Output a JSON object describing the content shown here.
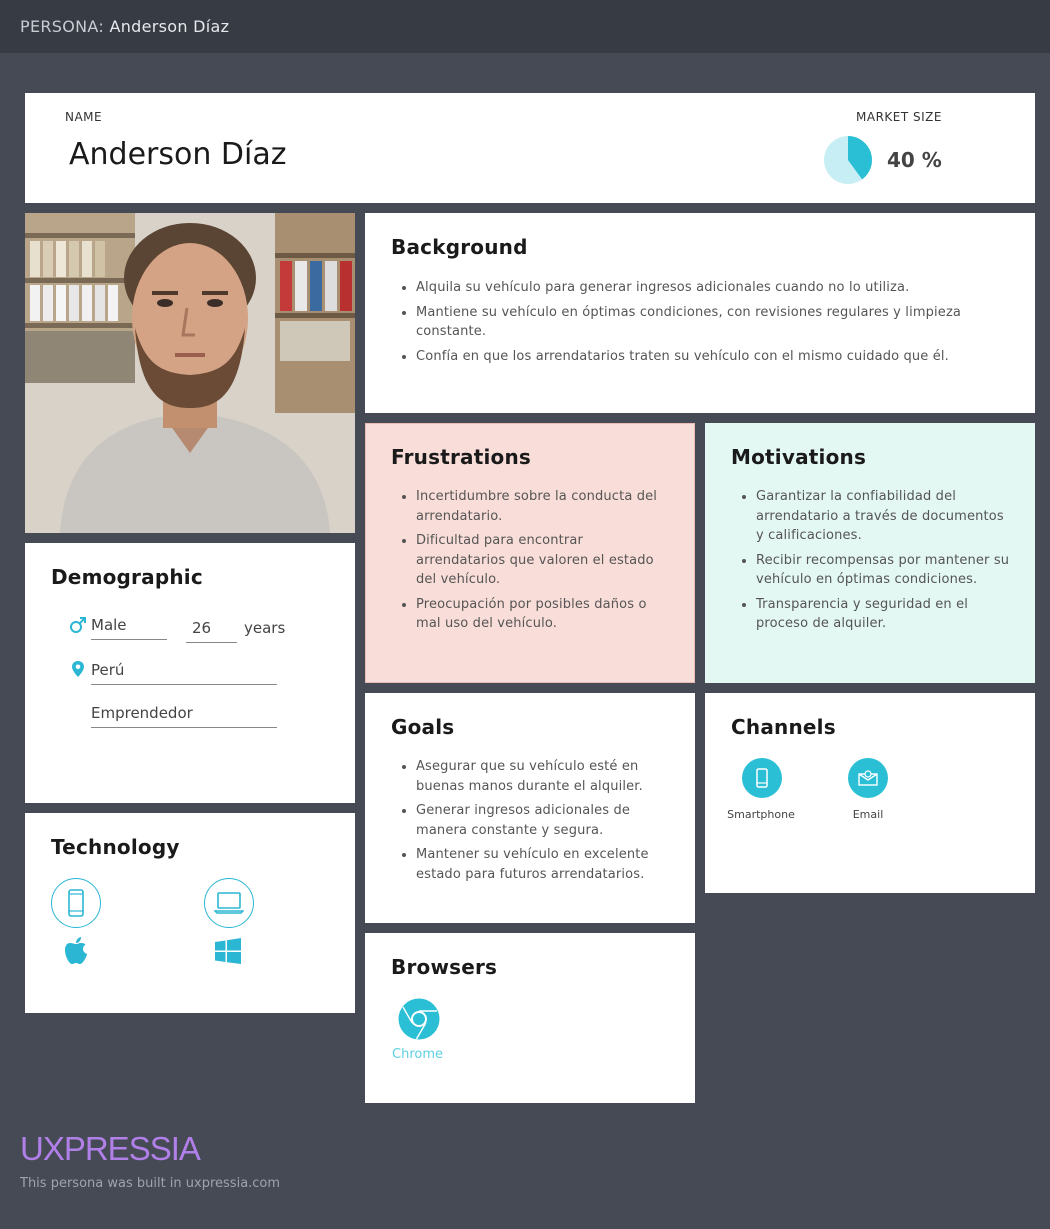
{
  "topbar": {
    "prefix": "PERSONA:",
    "name": "Anderson Díaz"
  },
  "header": {
    "name_label": "NAME",
    "name": "Anderson Díaz",
    "market_label": "MARKET SIZE",
    "market_value": "40 %",
    "market_fraction": 0.4
  },
  "demographic": {
    "title": "Demographic",
    "gender": "Male",
    "age": "26",
    "age_unit": "years",
    "location": "Perú",
    "occupation": "Emprendedor"
  },
  "technology": {
    "title": "Technology"
  },
  "background": {
    "title": "Background",
    "items": [
      "Alquila su vehículo para generar ingresos adicionales cuando no lo utiliza.",
      "Mantiene su vehículo en óptimas condiciones, con revisiones regulares y limpieza constante.",
      "Confía en que los arrendatarios traten su vehículo con el mismo cuidado que él."
    ]
  },
  "frustrations": {
    "title": "Frustrations",
    "items": [
      "Incertidumbre sobre la conducta del arrendatario.",
      "Dificultad para encontrar arrendatarios que valoren el estado del vehículo.",
      "Preocupación por posibles daños o mal uso del vehículo."
    ]
  },
  "motivations": {
    "title": "Motivations",
    "items": [
      "Garantizar la confiabilidad del arrendatario a través de documentos y calificaciones.",
      "Recibir recompensas por mantener su vehículo en óptimas condiciones.",
      "Transparencia y seguridad en el proceso de alquiler."
    ]
  },
  "goals": {
    "title": "Goals",
    "items": [
      "Asegurar que su vehículo esté en buenas manos durante el alquiler.",
      "Generar ingresos adicionales de manera constante y segura.",
      "Mantener su vehículo en excelente estado para futuros arrendatarios."
    ]
  },
  "channels": {
    "title": "Channels",
    "items": [
      "Smartphone",
      "Email"
    ]
  },
  "browsers": {
    "title": "Browsers",
    "items": [
      "Chrome"
    ]
  },
  "footer": {
    "logo": "UXPRESSIA",
    "text": "This persona was built in uxpressia.com"
  },
  "colors": {
    "accent": "#2bb7d4",
    "frustrations_bg": "#f9ddd8",
    "motivations_bg": "#e3f7f3",
    "logo": "#b07fe8"
  }
}
